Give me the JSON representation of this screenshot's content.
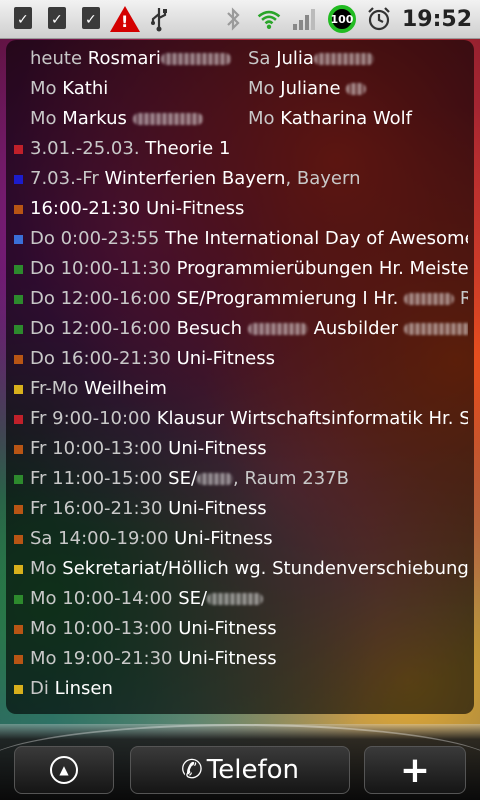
{
  "statusbar": {
    "battery_level": "100",
    "time": "19:52",
    "icons": [
      "download-done-icon",
      "download-done-icon",
      "download-done-icon",
      "warning-icon",
      "usb-icon",
      "bluetooth-icon",
      "wifi-icon",
      "signal-icon",
      "battery-icon",
      "alarm-icon"
    ]
  },
  "birthdays": [
    {
      "day": "heute",
      "name": "Rosmari"
    },
    {
      "day": "Sa",
      "name": "Julia"
    },
    {
      "day": "Mo",
      "name": "Kathi"
    },
    {
      "day": "Mo",
      "name": "Juliane"
    },
    {
      "day": "Mo",
      "name": "Markus"
    },
    {
      "day": "Mo",
      "name": "Katharina Wolf"
    }
  ],
  "events": [
    {
      "color": "#c0202a",
      "when": "3.01.-25.03.",
      "what": "Theorie 1",
      "loc": ""
    },
    {
      "color": "#1c1ccc",
      "when": "7.03.-Fr",
      "what": "Winterferien Bayern",
      "loc": ", Bayern"
    },
    {
      "color": "#b85514",
      "when": "",
      "what": " 16:00-21:30 Uni-Fitness",
      "loc": ""
    },
    {
      "color": "#3a6fd8",
      "when": "Do 0:00-23:55",
      "what": "The International Day of Awesomeness",
      "loc": ""
    },
    {
      "color": "#2d8a2d",
      "when": "Do 10:00-11:30",
      "what": "Programmierübungen Hr. Meister",
      "loc": ""
    },
    {
      "color": "#2d8a2d",
      "when": "Do 12:00-16:00",
      "what": "SE/Programmierung I Hr.",
      "loc": " Ra"
    },
    {
      "color": "#2d8a2d",
      "when": "Do 12:00-16:00",
      "what": "Besuch",
      "loc": "Ausbilder"
    },
    {
      "color": "#b85514",
      "when": "Do 16:00-21:30",
      "what": "Uni-Fitness",
      "loc": ""
    },
    {
      "color": "#d8b01c",
      "when": "Fr-Mo",
      "what": "Weilheim",
      "loc": ""
    },
    {
      "color": "#c0202a",
      "when": "Fr 9:00-10:00",
      "what": "Klausur Wirtschaftsinformatik Hr. S",
      "loc": ""
    },
    {
      "color": "#b85514",
      "when": "Fr 10:00-13:00",
      "what": "Uni-Fitness",
      "loc": ""
    },
    {
      "color": "#2d8a2d",
      "when": "Fr 11:00-15:00",
      "what": "SE/",
      "loc": ", Raum 237B"
    },
    {
      "color": "#b85514",
      "when": "Fr 16:00-21:30",
      "what": "Uni-Fitness",
      "loc": ""
    },
    {
      "color": "#b85514",
      "when": "Sa 14:00-19:00",
      "what": "Uni-Fitness",
      "loc": ""
    },
    {
      "color": "#d8b01c",
      "when": "Mo",
      "what": "Sekretariat/Höllich wg. Stundenverschiebung",
      "loc": ""
    },
    {
      "color": "#2d8a2d",
      "when": "Mo 10:00-14:00",
      "what": "SE/",
      "loc": ""
    },
    {
      "color": "#b85514",
      "when": "Mo 10:00-13:00",
      "what": "Uni-Fitness",
      "loc": ""
    },
    {
      "color": "#b85514",
      "when": "Mo 19:00-21:30",
      "what": "Uni-Fitness",
      "loc": ""
    },
    {
      "color": "#d8b01c",
      "when": "Di",
      "what": "Linsen",
      "loc": ""
    }
  ],
  "dock": {
    "phone_label": "Telefon",
    "plus_label": "+"
  }
}
